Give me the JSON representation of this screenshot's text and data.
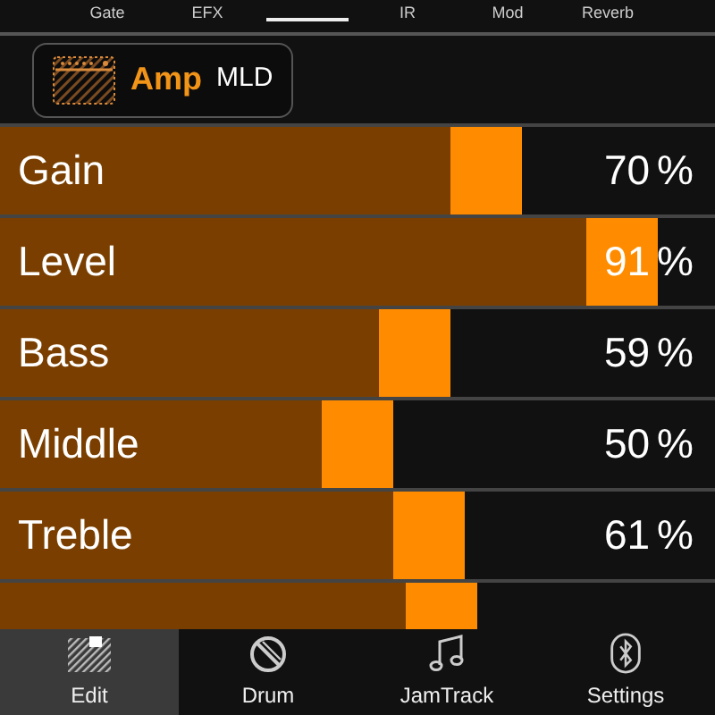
{
  "top_tabs": [
    {
      "label": "Gate",
      "selected": false
    },
    {
      "label": "EFX",
      "selected": false
    },
    {
      "selected": true
    },
    {
      "label": "IR",
      "selected": false
    },
    {
      "label": "Mod",
      "selected": false
    },
    {
      "label": "Reverb",
      "selected": false
    }
  ],
  "module": {
    "name": "Amp",
    "model": "MLD"
  },
  "params": [
    {
      "label": "Gain",
      "value": "70",
      "unit": "%",
      "level": 0.7
    },
    {
      "label": "Level",
      "value": "91",
      "unit": "%",
      "level": 0.91
    },
    {
      "label": "Bass",
      "value": "59",
      "unit": "%",
      "level": 0.59
    },
    {
      "label": "Middle",
      "value": "50",
      "unit": "%",
      "level": 0.5
    },
    {
      "label": "Treble",
      "value": "61",
      "unit": "%",
      "level": 0.61
    },
    {
      "level": 0.63
    }
  ],
  "bottom_nav": [
    {
      "label": "Edit",
      "selected": true
    },
    {
      "label": "Drum",
      "selected": false
    },
    {
      "label": "JamTrack",
      "selected": false
    },
    {
      "label": "Settings",
      "selected": false
    }
  ]
}
